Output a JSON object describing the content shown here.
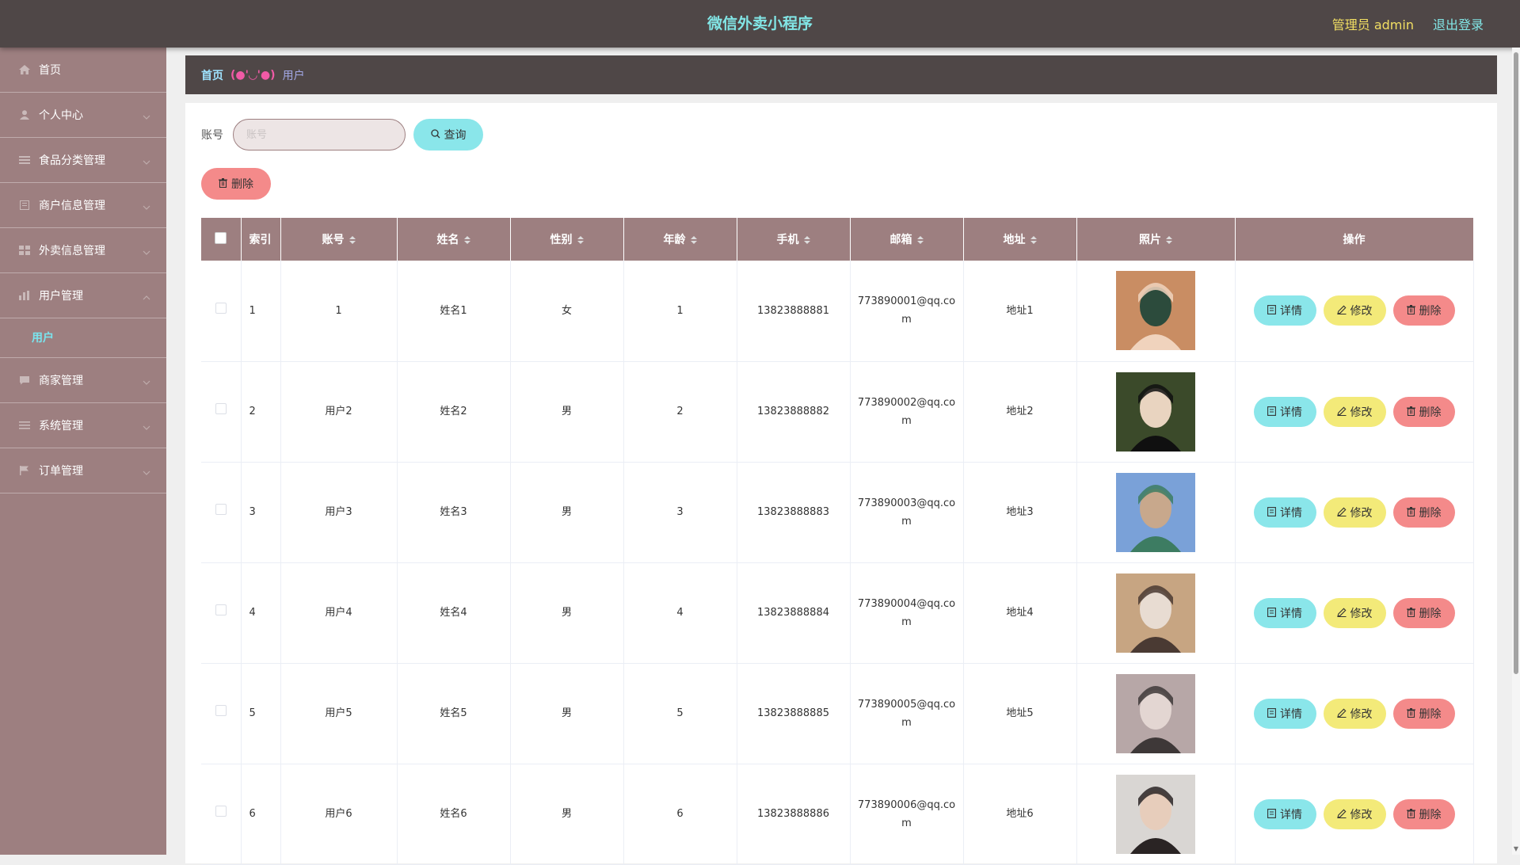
{
  "header": {
    "app_title": "微信外卖小程序",
    "admin_label": "管理员 admin",
    "logout_label": "退出登录"
  },
  "sidebar": {
    "items": [
      {
        "label": "首页",
        "icon": "home-icon"
      },
      {
        "label": "个人中心",
        "icon": "user-icon"
      },
      {
        "label": "食品分类管理",
        "icon": "menu-icon"
      },
      {
        "label": "商户信息管理",
        "icon": "document-icon"
      },
      {
        "label": "外卖信息管理",
        "icon": "grid-icon"
      },
      {
        "label": "用户管理",
        "icon": "chart-icon"
      },
      {
        "label": "商家管理",
        "icon": "chat-icon"
      },
      {
        "label": "系统管理",
        "icon": "list-icon"
      },
      {
        "label": "订单管理",
        "icon": "flag-icon"
      }
    ],
    "active_sub": "用户"
  },
  "breadcrumb": {
    "home": "首页",
    "separator": "(●'◡'●)",
    "current": "用户"
  },
  "search": {
    "label": "账号",
    "placeholder": "账号",
    "value": "",
    "button_label": "查询"
  },
  "actions": {
    "bulk_delete_label": "删除"
  },
  "table": {
    "headers": [
      "索引",
      "账号",
      "姓名",
      "性别",
      "年龄",
      "手机",
      "邮箱",
      "地址",
      "照片",
      "操作"
    ],
    "rows": [
      {
        "index": "1",
        "account": "1",
        "name": "姓名1",
        "gender": "女",
        "age": "1",
        "phone": "13823888881",
        "email": "773890001@qq.com",
        "address": "地址1"
      },
      {
        "index": "2",
        "account": "用户2",
        "name": "姓名2",
        "gender": "男",
        "age": "2",
        "phone": "13823888882",
        "email": "773890002@qq.com",
        "address": "地址2"
      },
      {
        "index": "3",
        "account": "用户3",
        "name": "姓名3",
        "gender": "男",
        "age": "3",
        "phone": "13823888883",
        "email": "773890003@qq.com",
        "address": "地址3"
      },
      {
        "index": "4",
        "account": "用户4",
        "name": "姓名4",
        "gender": "男",
        "age": "4",
        "phone": "13823888884",
        "email": "773890004@qq.com",
        "address": "地址4"
      },
      {
        "index": "5",
        "account": "用户5",
        "name": "姓名5",
        "gender": "男",
        "age": "5",
        "phone": "13823888885",
        "email": "773890005@qq.com",
        "address": "地址5"
      },
      {
        "index": "6",
        "account": "用户6",
        "name": "姓名6",
        "gender": "男",
        "age": "6",
        "phone": "13823888886",
        "email": "773890006@qq.com",
        "address": "地址6"
      }
    ],
    "op_labels": {
      "detail": "详情",
      "edit": "修改",
      "delete": "删除"
    }
  },
  "colors": {
    "topbar": "#4f4747",
    "sidebar": "#9d7f80",
    "title": "#82e6e6",
    "admin": "#f2df63",
    "detail_button": "#8ae6ea",
    "edit_button": "#f3ea79",
    "delete_button": "#f48a8a"
  }
}
